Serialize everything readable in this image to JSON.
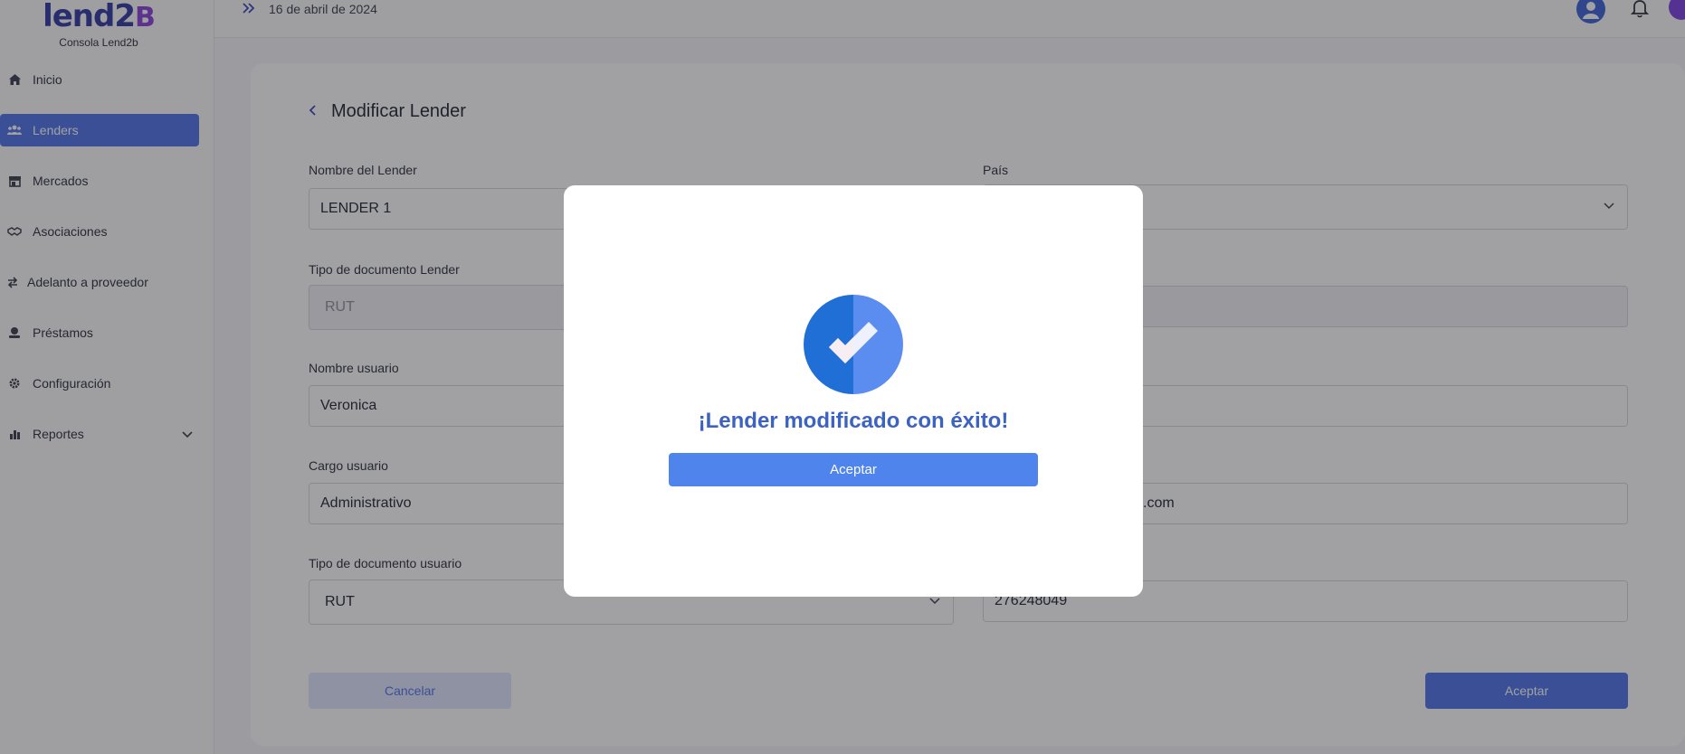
{
  "brand": {
    "logo_main": "lend2",
    "logo_b": "B",
    "subtitle": "Consola Lend2b"
  },
  "sidebar": {
    "items": [
      {
        "label": "Inicio",
        "icon": "home-icon"
      },
      {
        "label": "Lenders",
        "icon": "users-icon",
        "active": true
      },
      {
        "label": "Mercados",
        "icon": "store-icon"
      },
      {
        "label": "Asociaciones",
        "icon": "handshake-icon"
      },
      {
        "label": "Adelanto a proveedor",
        "icon": "swap-arrows-icon"
      },
      {
        "label": "Préstamos",
        "icon": "loan-icon"
      },
      {
        "label": "Configuración",
        "icon": "gear-icon"
      },
      {
        "label": "Reportes",
        "icon": "bar-chart-icon",
        "expandable": true
      }
    ]
  },
  "topbar": {
    "date": "16 de abril de 2024"
  },
  "form": {
    "title": "Modificar Lender",
    "lender_name_label": "Nombre del Lender",
    "lender_name_value": "LENDER 1",
    "country_label": "País",
    "lender_doc_type_label": "Tipo de documento Lender",
    "lender_doc_type_value": "RUT",
    "user_name_label": "Nombre usuario",
    "user_name_value": "Veronica",
    "user_position_label": "Cargo usuario",
    "user_position_value": "Administrativo",
    "email_partial_value": "ail.com",
    "user_doc_type_label": "Tipo de documento usuario",
    "user_doc_type_value": "RUT",
    "user_doc_number_value": "276248049",
    "cancel_label": "Cancelar",
    "accept_label": "Aceptar"
  },
  "modal": {
    "message": "¡Lender modificado con éxito!",
    "accept_label": "Aceptar"
  },
  "colors": {
    "primary": "#4f72e6",
    "modal_title": "#3c63c2",
    "check_dark": "#1f6fd6",
    "check_light": "#5b8cf0"
  }
}
